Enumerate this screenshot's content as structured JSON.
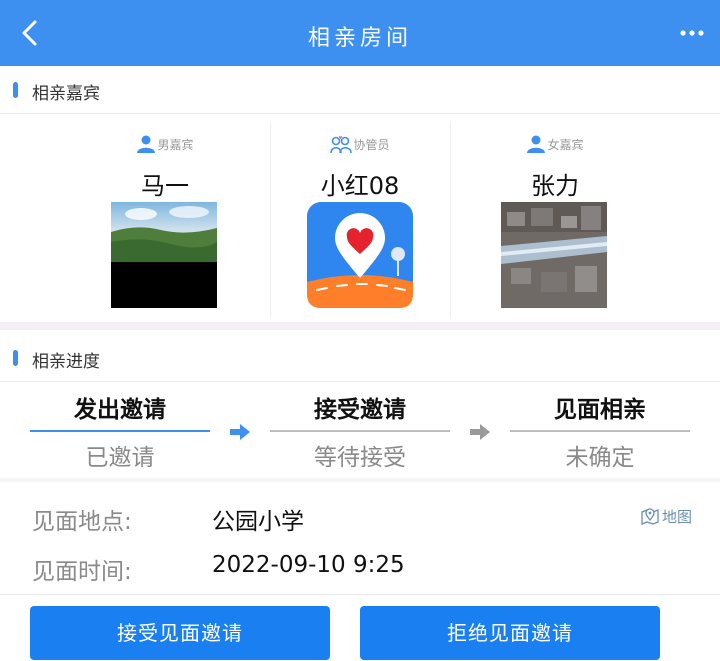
{
  "header": {
    "title": "相亲房间",
    "back_icon": "chevron-left-icon",
    "more_icon": "more-dots-icon",
    "bg_color": "#3d8ff0"
  },
  "guests_section": {
    "title": "相亲嘉宾",
    "guests": [
      {
        "role": "男嘉宾",
        "name": "马一",
        "role_icon": "male-user-icon",
        "photo": "landscape-photo"
      },
      {
        "role": "协管员",
        "name": "小红08",
        "role_icon": "matchmaker-icon",
        "photo": "app-logo-heart-pin"
      },
      {
        "role": "女嘉宾",
        "name": "张力",
        "role_icon": "female-user-icon",
        "photo": "abstract-photo"
      }
    ]
  },
  "progress_section": {
    "title": "相亲进度",
    "steps": [
      {
        "title": "发出邀请",
        "status": "已邀请",
        "active": true
      },
      {
        "title": "接受邀请",
        "status": "等待接受",
        "active": false
      },
      {
        "title": "见面相亲",
        "status": "未确定",
        "active": false
      }
    ],
    "active_color": "#3d8ff0"
  },
  "meeting": {
    "place_label": "见面地点:",
    "place_value": "公园小学",
    "map_link": "地图",
    "time_label": "见面时间:",
    "time_value": "2022-09-10 9:25"
  },
  "actions": {
    "accept_label": "接受见面邀请",
    "reject_label": "拒绝见面邀请",
    "button_color": "#1a7ff0"
  }
}
